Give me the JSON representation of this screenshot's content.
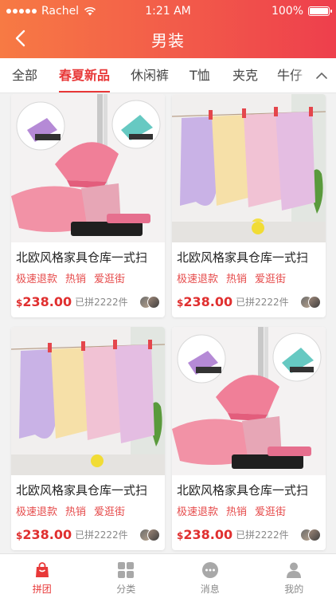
{
  "status_bar": {
    "carrier": "Rachel",
    "time": "1:21 AM",
    "battery": "100%",
    "battery_level": 1.0
  },
  "nav": {
    "title": "男装",
    "back_icon": "chevron-left-icon"
  },
  "tabs": [
    {
      "label": "全部",
      "active": false
    },
    {
      "label": "春夏新品",
      "active": true
    },
    {
      "label": "休闲裤",
      "active": false
    },
    {
      "label": "T恤",
      "active": false
    },
    {
      "label": "夹克",
      "active": false
    },
    {
      "label": "牛仔",
      "active": false
    }
  ],
  "tabs_expand_icon": "chevron-up-icon",
  "products": [
    {
      "image": "broom-dustpan-set",
      "title": "北欧风格家具仓库一式扫",
      "tags": [
        "极速退款",
        "热销",
        "爱逛街"
      ],
      "currency": "$",
      "price": "238.00",
      "sold": "已拼2222件"
    },
    {
      "image": "hanging-towels",
      "title": "北欧风格家具仓库一式扫",
      "tags": [
        "极速退款",
        "热销",
        "爱逛街"
      ],
      "currency": "$",
      "price": "238.00",
      "sold": "已拼2222件"
    },
    {
      "image": "hanging-towels",
      "title": "北欧风格家具仓库一式扫",
      "tags": [
        "极速退款",
        "热销",
        "爱逛街"
      ],
      "currency": "$",
      "price": "238.00",
      "sold": "已拼2222件"
    },
    {
      "image": "broom-dustpan-set",
      "title": "北欧风格家具仓库一式扫",
      "tags": [
        "极速退款",
        "热销",
        "爱逛街"
      ],
      "currency": "$",
      "price": "238.00",
      "sold": "已拼2222件"
    }
  ],
  "tabbar": [
    {
      "label": "拼团",
      "icon": "shopping-bag-icon",
      "active": true
    },
    {
      "label": "分类",
      "icon": "grid-icon",
      "active": false
    },
    {
      "label": "消息",
      "icon": "chat-icon",
      "active": false
    },
    {
      "label": "我的",
      "icon": "person-icon",
      "active": false
    }
  ],
  "colors": {
    "accent": "#e83838",
    "header_start": "#f77a44",
    "header_end": "#ee3f4c"
  }
}
